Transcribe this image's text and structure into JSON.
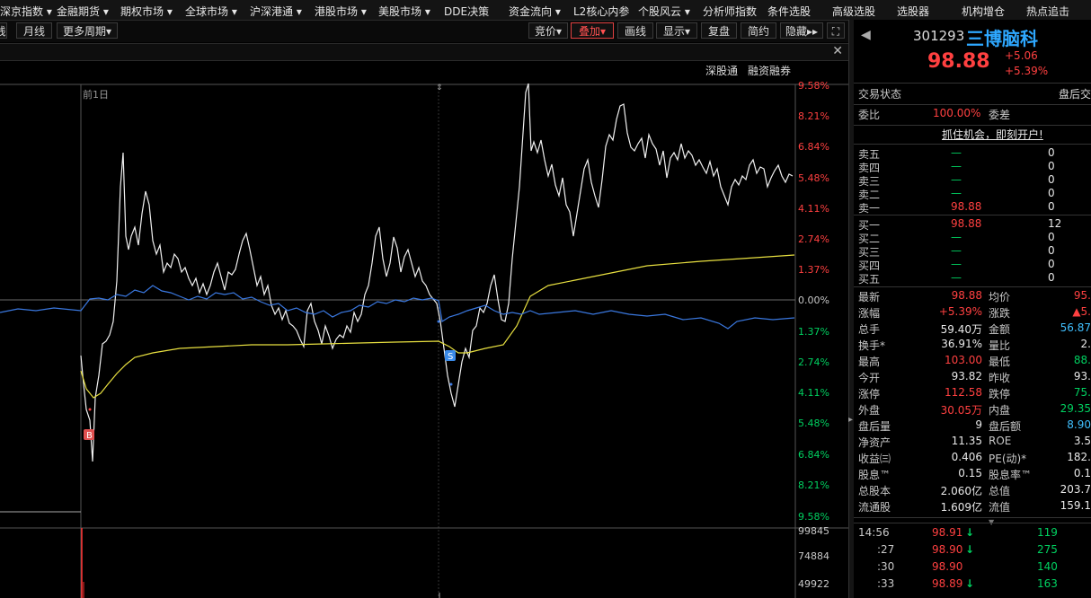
{
  "menu": [
    "深京指数",
    "金融期货",
    "期权市场",
    "全球市场",
    "沪深港通",
    "港股市场",
    "美股市场",
    "DDE决策",
    "资金流向",
    "L2核心内参",
    "个股风云",
    "分析师指数",
    "条件选股",
    "高级选股",
    "选股器",
    "机构增仓",
    "热点追击"
  ],
  "menu_dd": [
    "▾",
    "▾",
    "▾",
    "▾",
    "▾",
    "▾",
    "▾",
    "",
    "▾",
    "",
    "▾",
    "",
    "",
    "",
    "",
    "",
    ""
  ],
  "toolbar": {
    "left_cut": "线",
    "monthly": "月线",
    "more_period": "更多周期",
    "more_arrow": "▾",
    "bid": "竞价",
    "overlay": "叠加",
    "draw": "画线",
    "display": "显示",
    "replay": "复盘",
    "simple": "简约",
    "hide": "隐藏"
  },
  "subbar": {
    "sz_connect": "深股通",
    "margin": "融资融券",
    "prev_day": "前1日"
  },
  "axis_labels_pct": [
    "9.58%",
    "8.21%",
    "6.84%",
    "5.48%",
    "4.11%",
    "2.74%",
    "1.37%",
    "0.00%",
    "1.37%",
    "2.74%",
    "4.11%",
    "5.48%",
    "6.84%",
    "8.21%",
    "9.58%"
  ],
  "volume_labels": [
    "99845",
    "74884",
    "49922"
  ],
  "marker_b": "B",
  "marker_s": "S",
  "stock": {
    "code": "301293",
    "name": "三博脑科",
    "price": "98.88",
    "change": "+5.06",
    "change_pct": "+5.39%"
  },
  "status": {
    "label": "交易状态",
    "value": "盘后交"
  },
  "weibi": {
    "label": "委比",
    "value": "100.00%",
    "label2": "委差"
  },
  "promo": "抓住机会，即刻开户!",
  "asks": [
    {
      "l": "卖五",
      "p": "—",
      "v": "0"
    },
    {
      "l": "卖四",
      "p": "—",
      "v": "0"
    },
    {
      "l": "卖三",
      "p": "—",
      "v": "0"
    },
    {
      "l": "卖二",
      "p": "—",
      "v": "0"
    },
    {
      "l": "卖一",
      "p": "98.88",
      "v": "0"
    }
  ],
  "bids": [
    {
      "l": "买一",
      "p": "98.88",
      "v": "12"
    },
    {
      "l": "买二",
      "p": "—",
      "v": "0"
    },
    {
      "l": "买三",
      "p": "—",
      "v": "0"
    },
    {
      "l": "买四",
      "p": "—",
      "v": "0"
    },
    {
      "l": "买五",
      "p": "—",
      "v": "0"
    }
  ],
  "quote": [
    {
      "a": "最新",
      "av": "98.88",
      "ac": "red",
      "b": "均价",
      "bv": "95.",
      "bc": "red"
    },
    {
      "a": "涨幅",
      "av": "+5.39%",
      "ac": "red",
      "b": "涨跌",
      "bv": "▲5.",
      "bc": "red"
    },
    {
      "a": "总手",
      "av": "59.40万",
      "ac": "white",
      "b": "金额",
      "bv": "56.87",
      "bc": "cyan"
    },
    {
      "a": "换手*",
      "av": "36.91%",
      "ac": "white",
      "b": "量比",
      "bv": "2.",
      "bc": "white"
    },
    {
      "a": "最高",
      "av": "103.00",
      "ac": "red",
      "b": "最低",
      "bv": "88.",
      "bc": "green"
    },
    {
      "a": "今开",
      "av": "93.82",
      "ac": "white",
      "b": "昨收",
      "bv": "93.",
      "bc": "white"
    },
    {
      "a": "涨停",
      "av": "112.58",
      "ac": "red",
      "b": "跌停",
      "bv": "75.",
      "bc": "green"
    },
    {
      "a": "外盘",
      "av": "30.05万",
      "ac": "red",
      "b": "内盘",
      "bv": "29.35",
      "bc": "green"
    },
    {
      "a": "盘后量",
      "av": "9",
      "ac": "white",
      "b": "盘后额",
      "bv": "8.90",
      "bc": "cyan"
    },
    {
      "a": "净资产",
      "av": "11.35",
      "ac": "white",
      "b": "ROE",
      "bv": "3.5",
      "bc": "white"
    },
    {
      "a": "收益㈢",
      "av": "0.406",
      "ac": "white",
      "b": "PE(动)*",
      "bv": "182.",
      "bc": "white"
    },
    {
      "a": "股息™",
      "av": "0.15",
      "ac": "white",
      "b": "股息率™",
      "bv": "0.1",
      "bc": "white"
    },
    {
      "a": "总股本",
      "av": "2.060亿",
      "ac": "white",
      "b": "总值",
      "bv": "203.7",
      "bc": "white"
    },
    {
      "a": "流通股",
      "av": "1.609亿",
      "ac": "white",
      "b": "流值",
      "bv": "159.1",
      "bc": "white"
    }
  ],
  "ticks": [
    {
      "t": "14:56",
      "p": "98.91",
      "arr": "↓",
      "v": "119"
    },
    {
      "t": ":27",
      "p": "98.90",
      "arr": "↓",
      "v": "275"
    },
    {
      "t": ":30",
      "p": "98.90",
      "arr": "",
      "v": "140"
    },
    {
      "t": ":33",
      "p": "98.89",
      "arr": "↓",
      "v": "163"
    }
  ]
}
